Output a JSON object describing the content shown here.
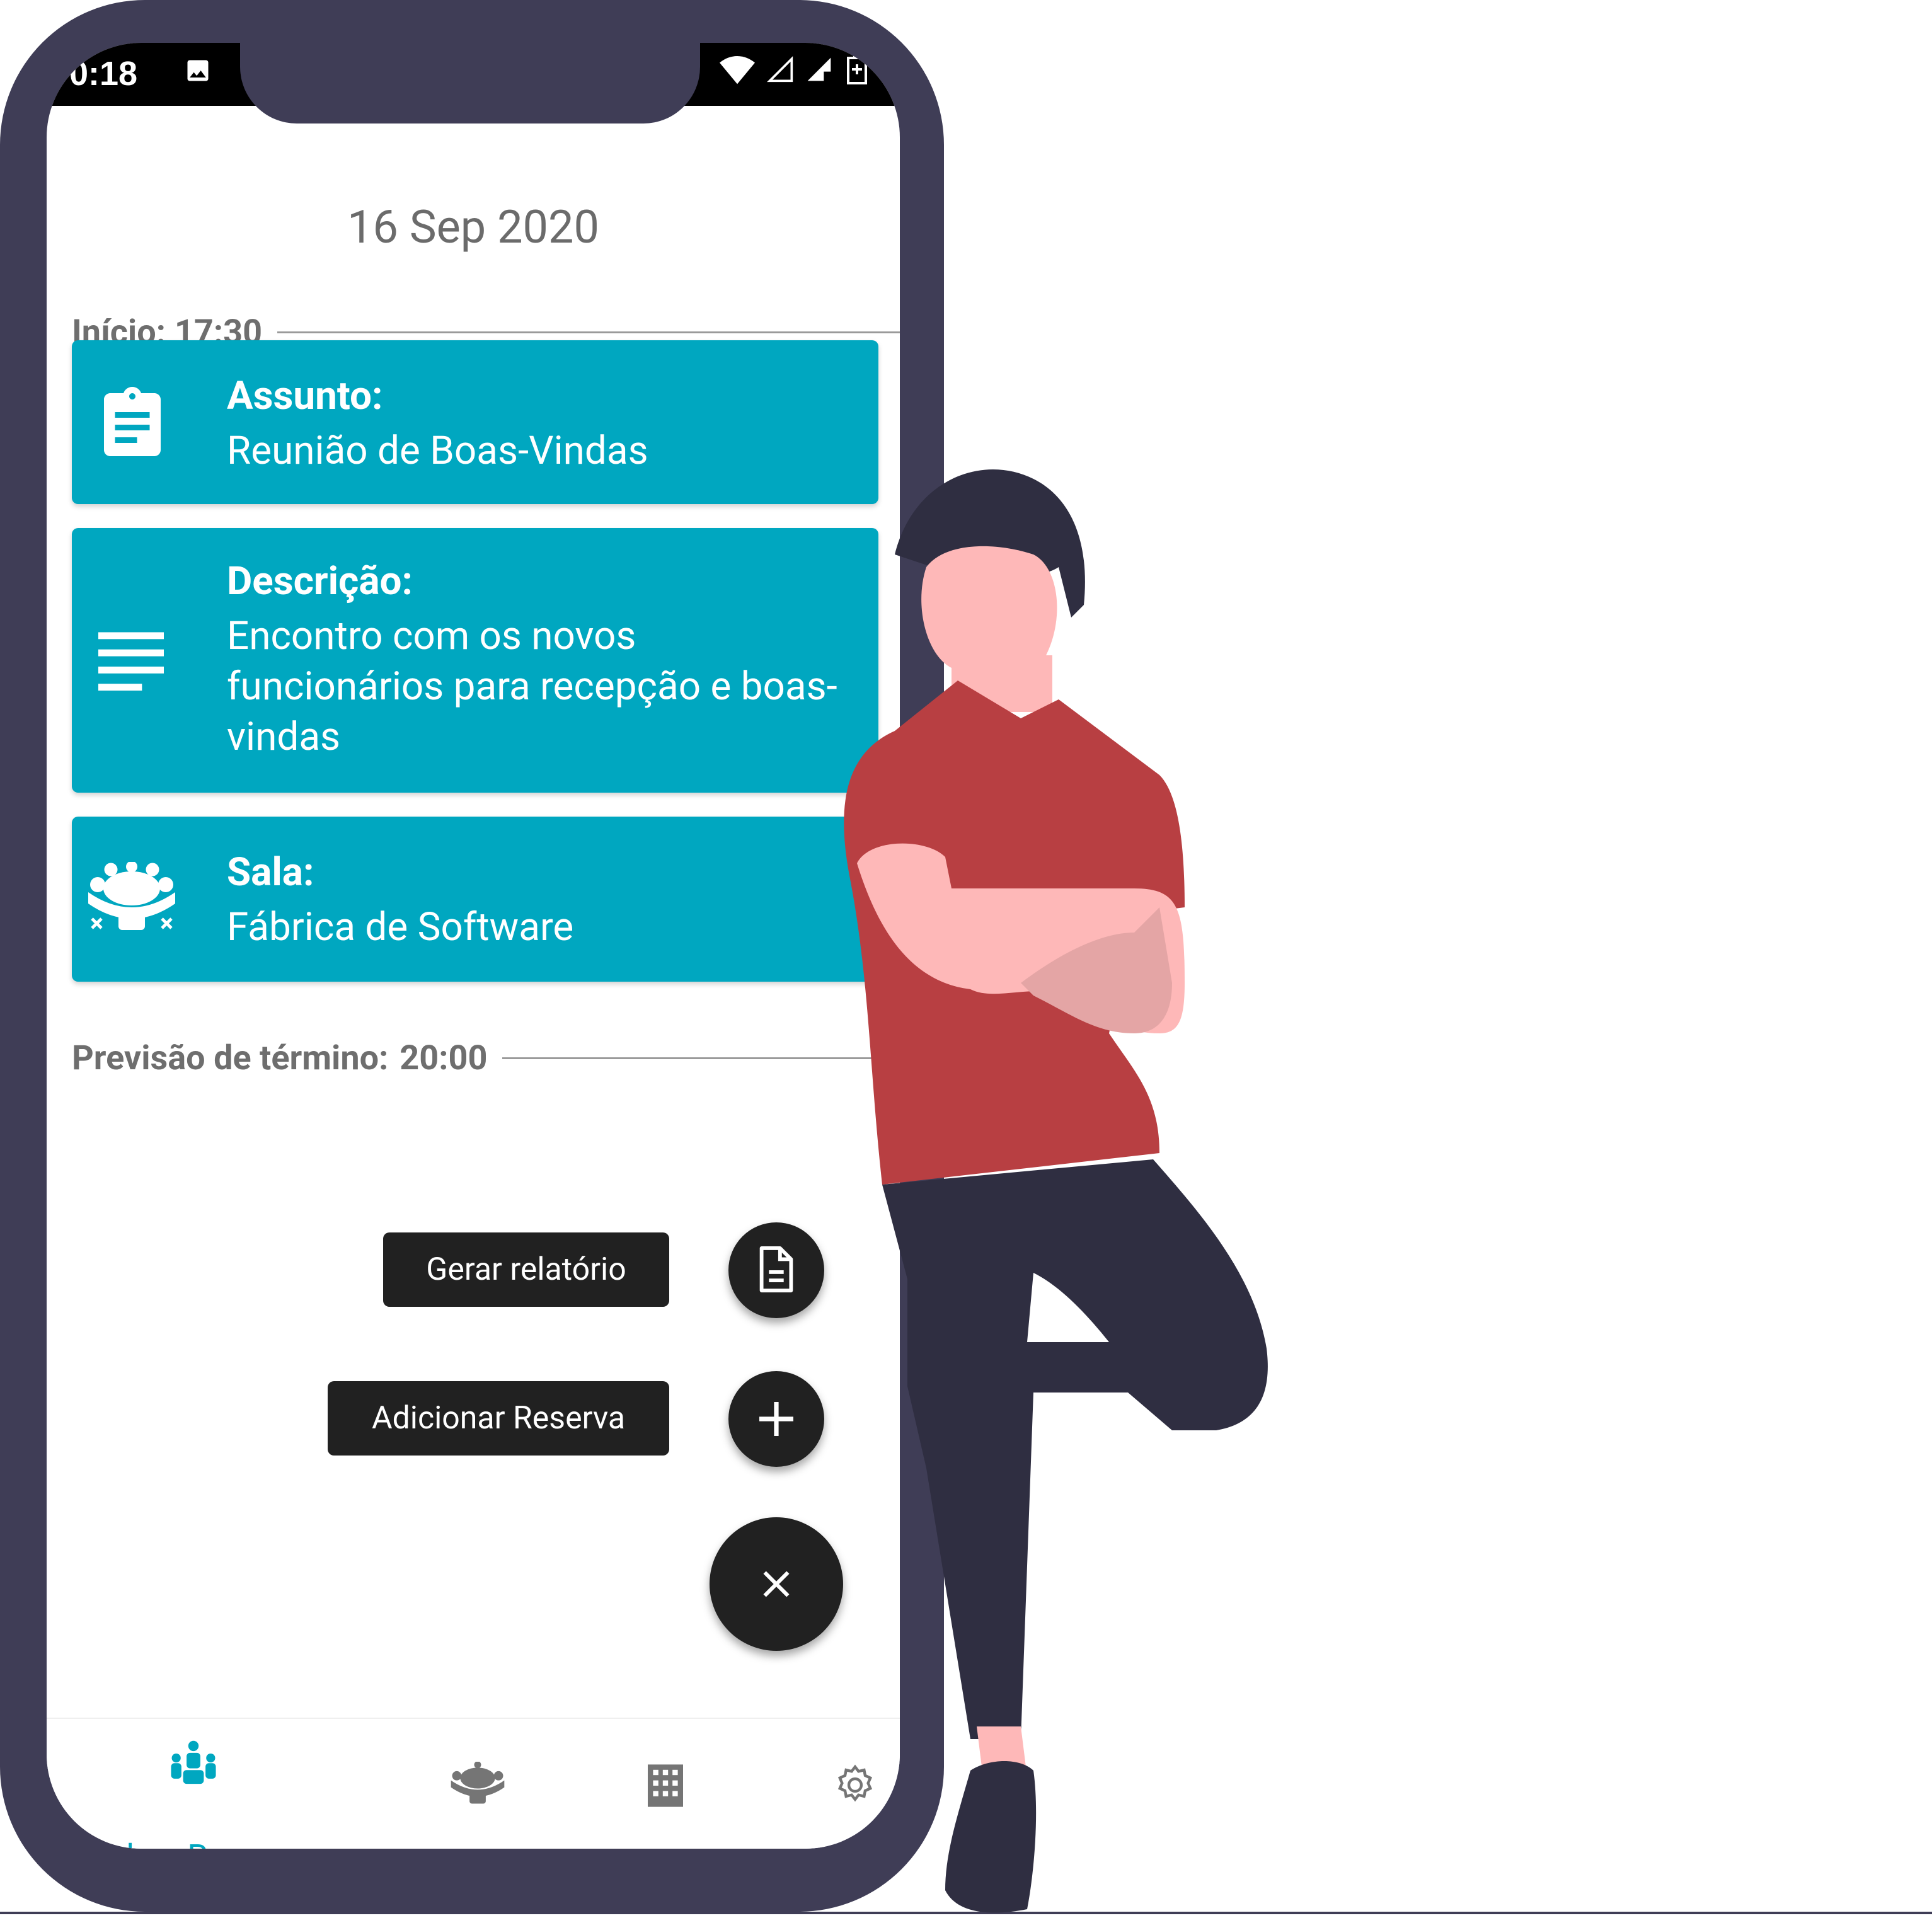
{
  "status_bar": {
    "time": "0:18"
  },
  "header": {
    "date": "16 Sep 2020"
  },
  "start": {
    "label": "Início:",
    "value": "17:30"
  },
  "cards": [
    {
      "title": "Assunto:",
      "value": "Reunião de Boas-Vindas",
      "icon": "clipboard-icon"
    },
    {
      "title": "Descrição:",
      "value": "Encontro com os novos funcionários para recepção e boas-vindas",
      "icon": "text-lines-icon"
    },
    {
      "title": "Sala:",
      "value": "Fábrica de Software",
      "icon": "meeting-table-icon"
    }
  ],
  "end": {
    "label": "Previsão de término:",
    "value": "20:00"
  },
  "speed_dial": {
    "report_label": "Gerar relatório",
    "add_label": "Adicionar Reserva"
  },
  "bottom_nav": {
    "active_label": "Minhas Reservas",
    "items": [
      "people-icon",
      "meeting-room-icon",
      "building-icon",
      "gear-icon"
    ],
    "accent": "#00a7c0"
  },
  "colors": {
    "card": "#00a7c0",
    "phone_frame": "#3f3d56",
    "fab": "#212121"
  }
}
